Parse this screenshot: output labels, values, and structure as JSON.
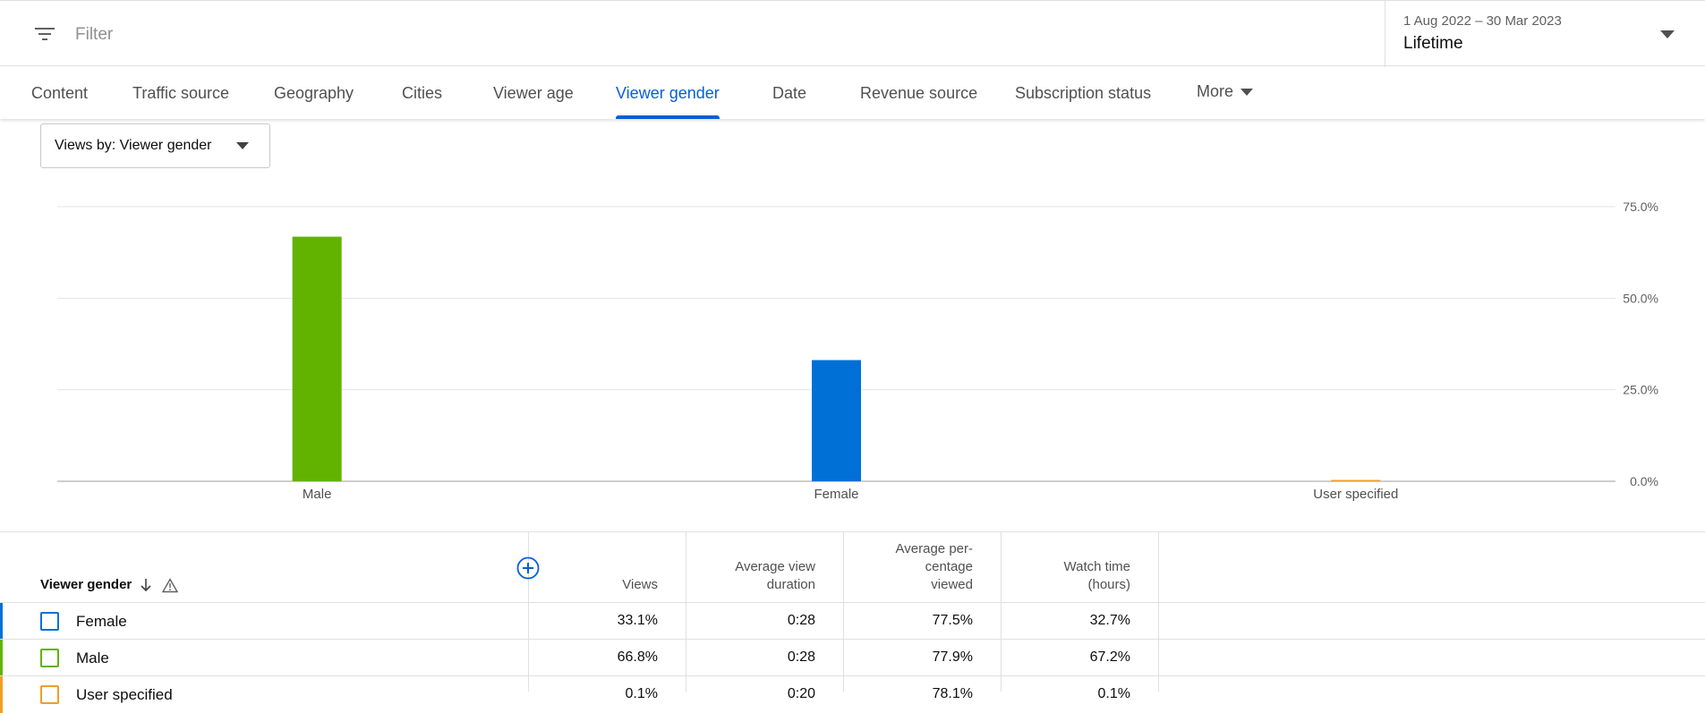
{
  "filter": {
    "placeholder": "Filter",
    "icon": "filter-icon"
  },
  "date_picker": {
    "range": "1 Aug 2022 – 30 Mar 2023",
    "label": "Lifetime",
    "icon": "chevron-down-icon"
  },
  "tabs": [
    {
      "label": "Content",
      "active": false
    },
    {
      "label": "Traffic source",
      "active": false
    },
    {
      "label": "Geography",
      "active": false
    },
    {
      "label": "Cities",
      "active": false
    },
    {
      "label": "Viewer age",
      "active": false
    },
    {
      "label": "Viewer gender",
      "active": true
    },
    {
      "label": "Date",
      "active": false
    },
    {
      "label": "Revenue source",
      "active": false
    },
    {
      "label": "Subscription status",
      "active": false
    }
  ],
  "more_tab": {
    "label": "More",
    "icon": "caret-down-icon"
  },
  "metric_select": {
    "label": "Views by: Viewer gender"
  },
  "colors": {
    "accent": "#065fd4",
    "male": "#62b300",
    "female": "#0070d6",
    "user_specified": "#f29e24"
  },
  "chart_data": {
    "type": "bar",
    "categories": [
      "Male",
      "Female",
      "User specified"
    ],
    "values": [
      66.8,
      33.1,
      0.1
    ],
    "colors": [
      "#62b300",
      "#0070d6",
      "#f29e24"
    ],
    "ylim": [
      0,
      75
    ],
    "yticks": [
      "0.0%",
      "25.0%",
      "50.0%",
      "75.0%"
    ],
    "ytick_values": [
      0,
      25,
      50,
      75
    ],
    "grid": true,
    "y_axis_side": "right"
  },
  "table": {
    "dimension_header": "Viewer gender",
    "sort_icon": "arrow-down-icon",
    "warning_icon": "warning-icon",
    "add_column_icon": "add-circle-icon",
    "columns": [
      {
        "lines": [
          "Views"
        ]
      },
      {
        "lines": [
          "Average view",
          "duration"
        ]
      },
      {
        "lines": [
          "Average per-",
          "centage",
          "viewed"
        ]
      },
      {
        "lines": [
          "Watch time",
          "(hours)"
        ]
      }
    ],
    "rows": [
      {
        "label": "Female",
        "color": "#0070d6",
        "cells": [
          "33.1%",
          "0:28",
          "77.5%",
          "32.7%"
        ]
      },
      {
        "label": "Male",
        "color": "#62b300",
        "cells": [
          "66.8%",
          "0:28",
          "77.9%",
          "67.2%"
        ]
      },
      {
        "label": "User specified",
        "color": "#f29e24",
        "cells": [
          "0.1%",
          "0:20",
          "78.1%",
          "0.1%"
        ]
      }
    ]
  }
}
